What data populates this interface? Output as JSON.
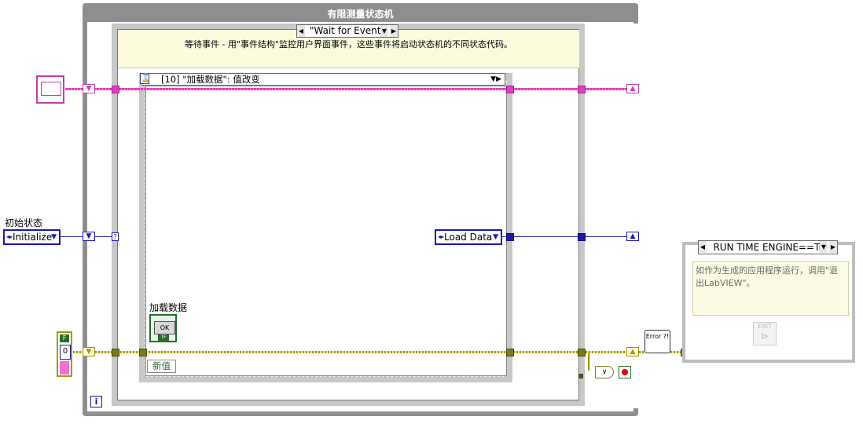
{
  "loop": {
    "title": "有限测量状态机",
    "iteration_icon": "i"
  },
  "case": {
    "selector": "\"Wait for Event\"",
    "comment": "等待事件 - 用\"事件结构\"监控用户界面事件，这些事件将启动状态机的不同状态代码。"
  },
  "event": {
    "selector": "[10] \"加载数据\": 值改变",
    "new_value": "新值",
    "button_label": "加载数据",
    "button_text": "OK",
    "button_type": "TF"
  },
  "initial_state": {
    "label": "初始状态",
    "value": "Initialize"
  },
  "next_state": {
    "value": "Load Data"
  },
  "error": {
    "bool_label": "F",
    "count": "0"
  },
  "handler": {
    "text": "Error ?!"
  },
  "or_gate": {
    "text": "∨"
  },
  "runtime_case": {
    "selector": "RUN TIME ENGINE==Tr",
    "comment": "如作为生成的应用程序运行，调用\"退出LabVIEW\"。",
    "exit_label": "EXIT"
  },
  "colors": {
    "refnum": "#e040c0",
    "enum": "#1a1aa0",
    "error": "#a09a00",
    "boolean": "#2a6a2a"
  }
}
